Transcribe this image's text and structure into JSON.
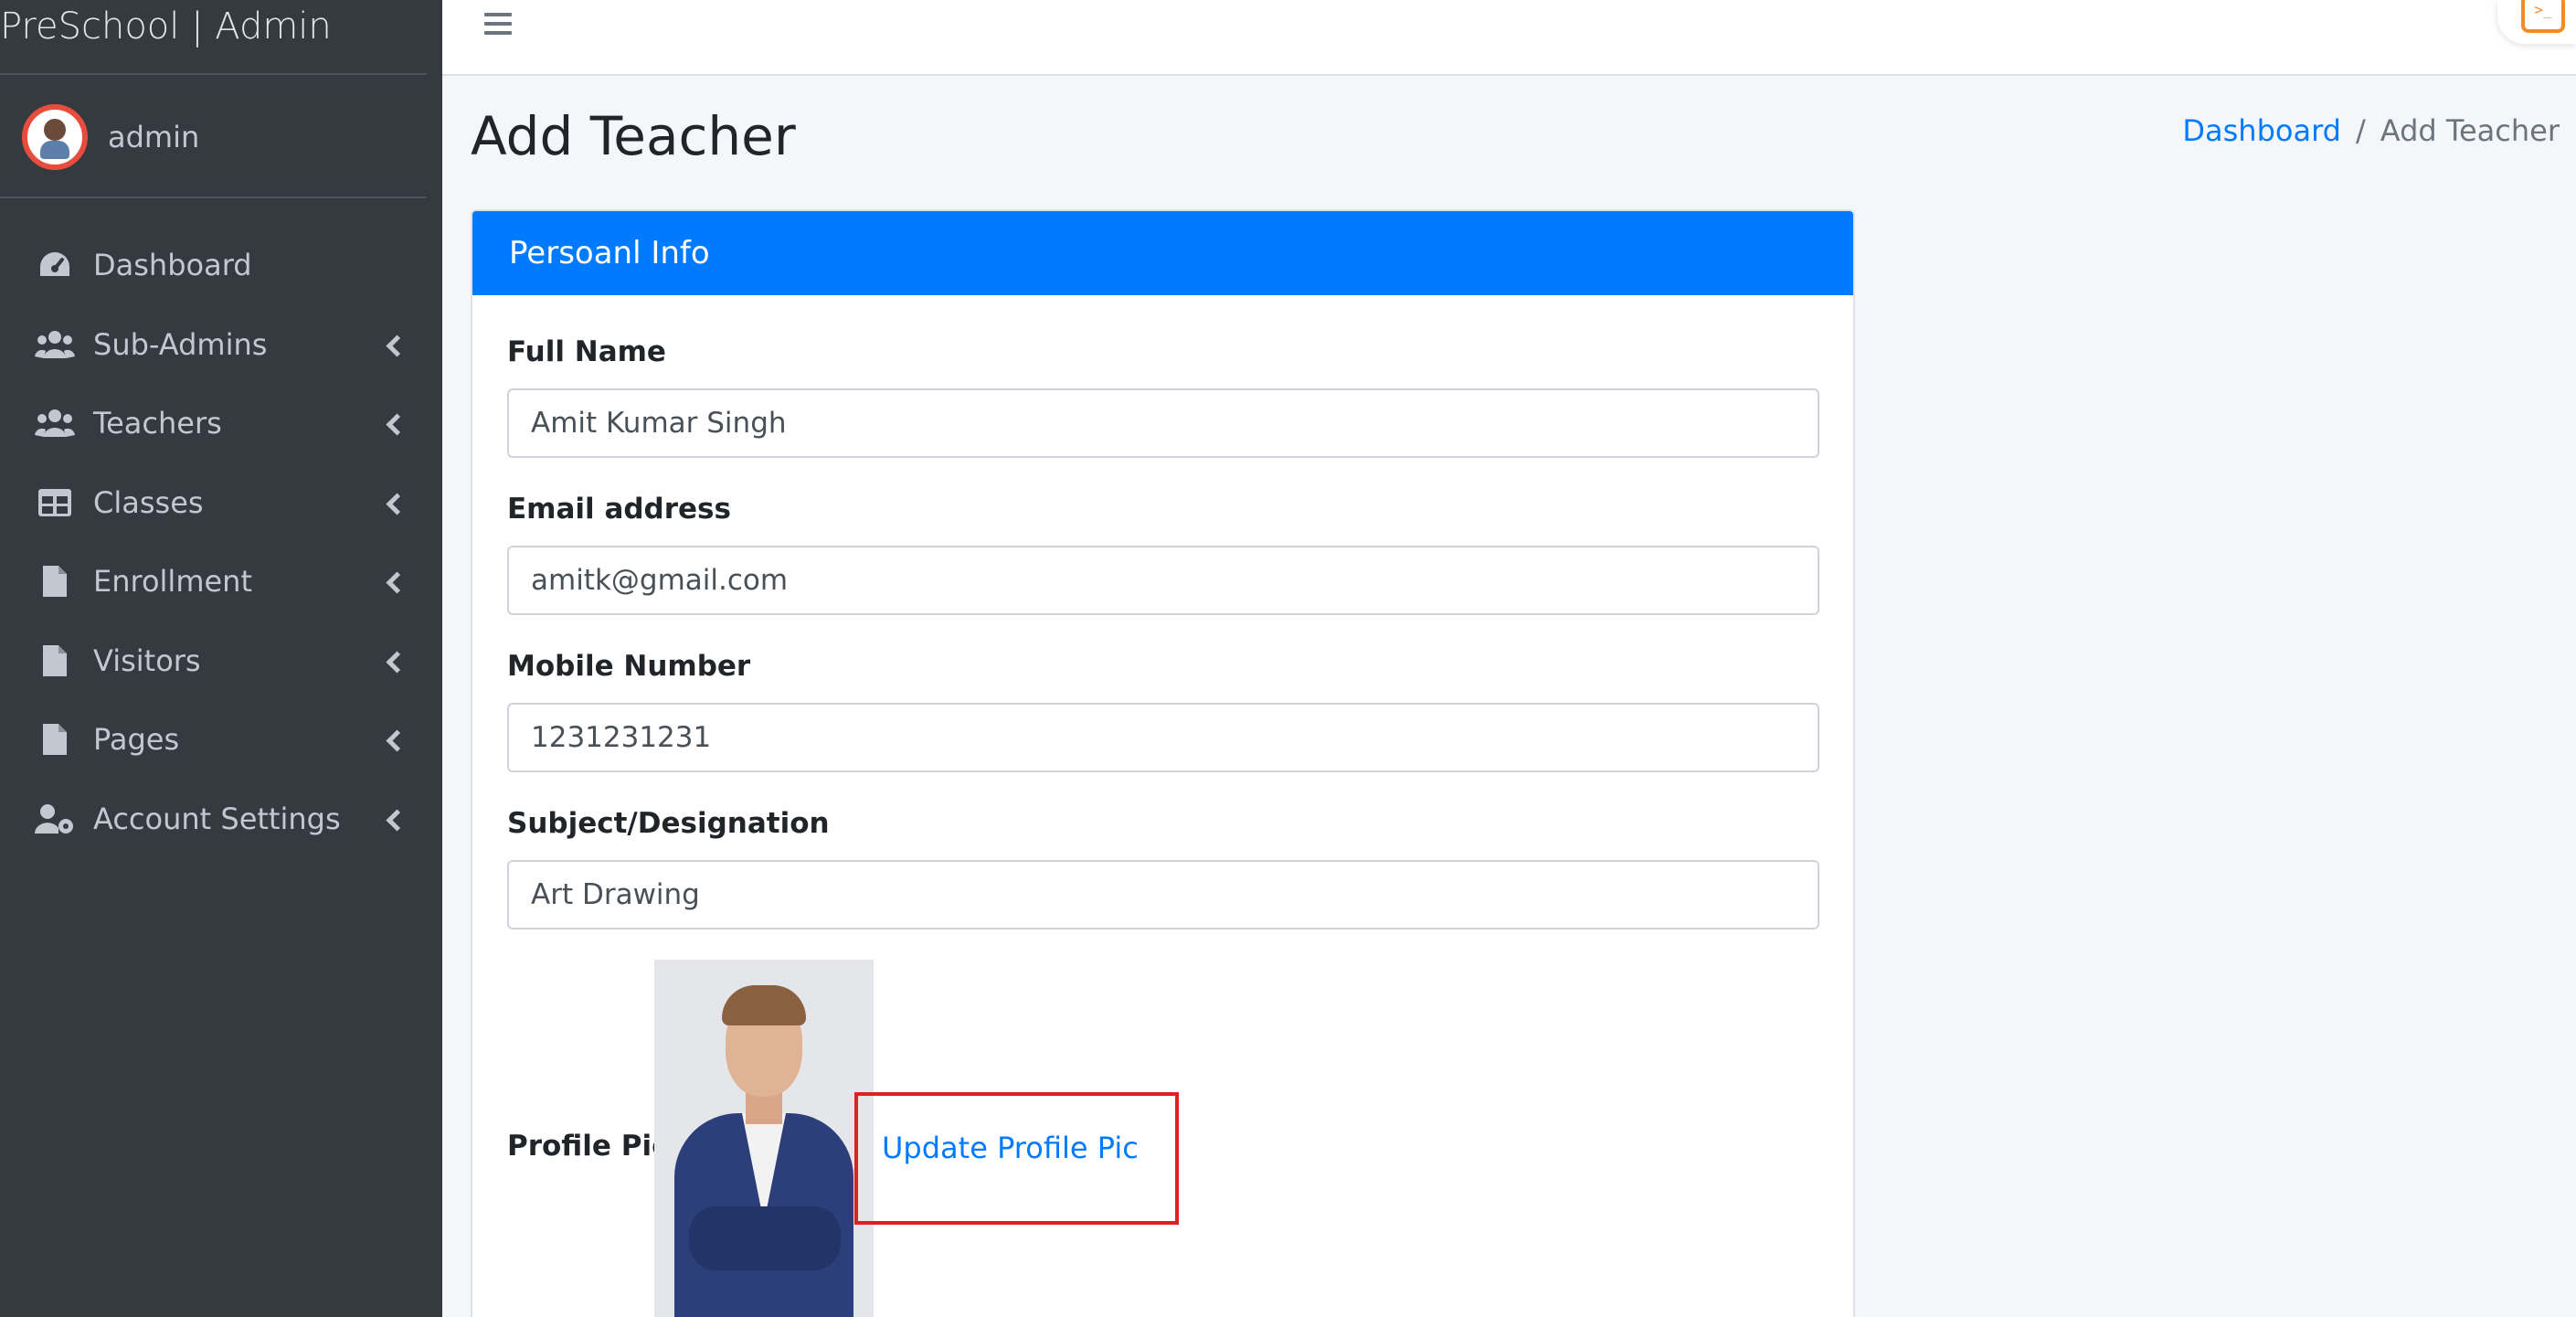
{
  "brand": {
    "title": "PreSchool | Admin"
  },
  "user": {
    "name": "admin"
  },
  "sidebar": {
    "items": [
      {
        "label": "Dashboard",
        "icon": "tachometer-icon",
        "has_submenu": false
      },
      {
        "label": "Sub-Admins",
        "icon": "users-icon",
        "has_submenu": true
      },
      {
        "label": "Teachers",
        "icon": "users-icon",
        "has_submenu": true
      },
      {
        "label": "Classes",
        "icon": "table-icon",
        "has_submenu": true
      },
      {
        "label": "Enrollment",
        "icon": "file-icon",
        "has_submenu": true
      },
      {
        "label": "Visitors",
        "icon": "file-icon",
        "has_submenu": true
      },
      {
        "label": "Pages",
        "icon": "file-icon",
        "has_submenu": true
      },
      {
        "label": "Account Settings",
        "icon": "user-cog-icon",
        "has_submenu": true
      }
    ]
  },
  "page": {
    "title": "Add Teacher"
  },
  "breadcrumb": {
    "home": "Dashboard",
    "separator": "/",
    "current": "Add Teacher"
  },
  "card": {
    "header": "Persoanl Info",
    "fields": {
      "full_name": {
        "label": "Full Name",
        "value": "Amit Kumar Singh"
      },
      "email": {
        "label": "Email address",
        "value": "amitk@gmail.com"
      },
      "mobile": {
        "label": "Mobile Number",
        "value": "1231231231"
      },
      "subject": {
        "label": "Subject/Designation",
        "value": "Art Drawing"
      }
    },
    "profile_pic": {
      "label": "Profile Pic",
      "link": "Update Profile Pic"
    }
  },
  "colors": {
    "sidebar_bg": "#343a40",
    "primary": "#007bff",
    "highlight": "#e02020"
  }
}
